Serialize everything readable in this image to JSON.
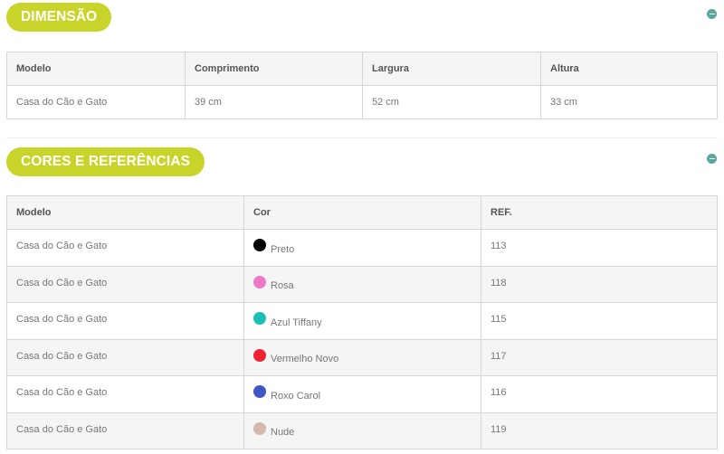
{
  "dimension": {
    "title": "DIMENSÃO",
    "headers": [
      "Modelo",
      "Comprimento",
      "Largura",
      "Altura"
    ],
    "rows": [
      [
        "Casa do Cão e Gato",
        "39 cm",
        "52 cm",
        "33 cm"
      ]
    ]
  },
  "colors_section": {
    "title": "CORES E REFERÊNCIAS",
    "headers": [
      "Modelo",
      "Cor",
      "REF."
    ],
    "rows": [
      {
        "model": "Casa do Cão e Gato",
        "color": "Preto",
        "hex": "#000000",
        "ref": "113"
      },
      {
        "model": "Casa do Cão e Gato",
        "color": "Rosa",
        "hex": "#ee79c8",
        "ref": "118"
      },
      {
        "model": "Casa do Cão e Gato",
        "color": "Azul Tiffany",
        "hex": "#1cbfb8",
        "ref": "115"
      },
      {
        "model": "Casa do Cão e Gato",
        "color": "Vermelho Novo",
        "hex": "#ee2233",
        "ref": "117"
      },
      {
        "model": "Casa do Cão e Gato",
        "color": "Roxo Carol",
        "hex": "#3f57c4",
        "ref": "116"
      },
      {
        "model": "Casa do Cão e Gato",
        "color": "Nude",
        "hex": "#d4b8aa",
        "ref": "119"
      }
    ]
  },
  "theme": {
    "accent": "#c9d42a",
    "toggle_color": "#5aa89a"
  }
}
